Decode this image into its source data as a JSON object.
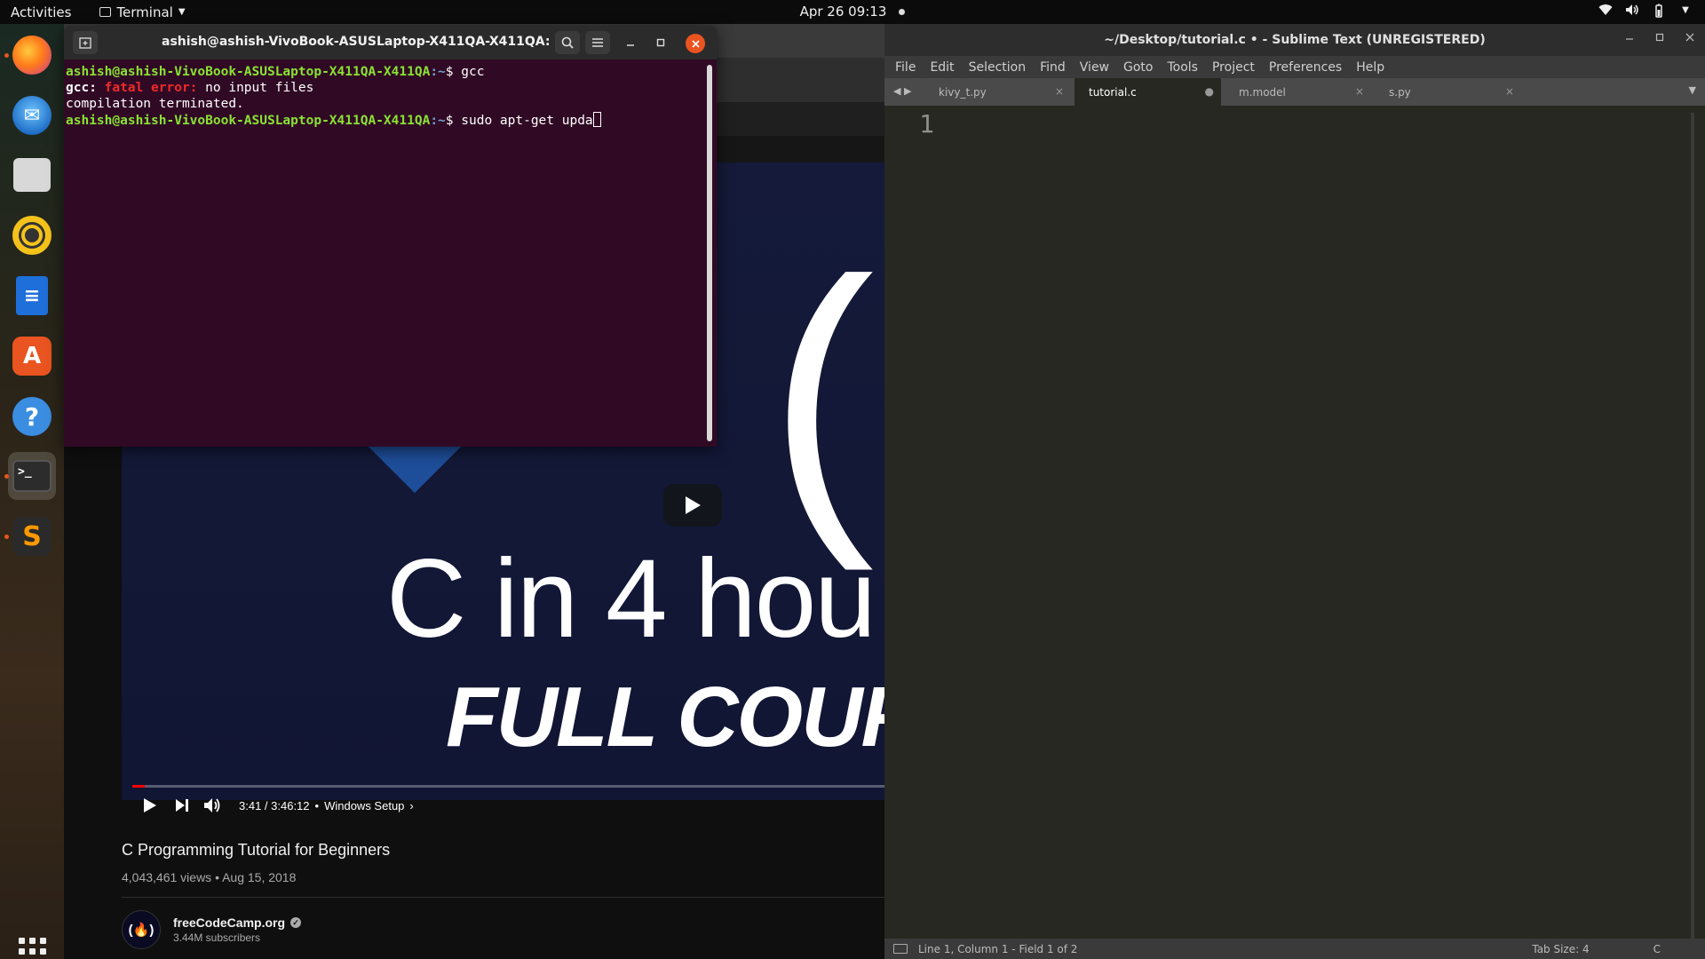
{
  "topbar": {
    "activities": "Activities",
    "app_menu": "Terminal",
    "clock": "Apr 26  09:13"
  },
  "dock": {
    "items": [
      {
        "name": "Firefox",
        "icon": "firefox-icon"
      },
      {
        "name": "Thunderbird",
        "icon": "thunderbird-icon"
      },
      {
        "name": "Files",
        "icon": "files-icon"
      },
      {
        "name": "Rhythmbox",
        "icon": "rhythmbox-icon"
      },
      {
        "name": "LibreOffice Writer",
        "icon": "writer-icon"
      },
      {
        "name": "Ubuntu Software",
        "icon": "software-store-icon"
      },
      {
        "name": "Help",
        "icon": "help-icon"
      },
      {
        "name": "Terminal",
        "icon": "terminal-icon",
        "active": true
      },
      {
        "name": "Sublime Text",
        "icon": "sublime-icon"
      },
      {
        "name": "Show Applications",
        "icon": "apps-grid-icon"
      }
    ]
  },
  "terminal": {
    "title": "ashish@ashish-VivoBook-ASUSLaptop-X411QA-X411QA: ~",
    "prompt_user": "ashish@ashish-VivoBook-ASUSLaptop-X411QA-X411QA",
    "prompt_path": "~",
    "lines": {
      "cmd1": "gcc",
      "err_prefix": "gcc: ",
      "err_kind": "fatal error: ",
      "err_msg": "no input files",
      "terminated": "compilation terminated.",
      "cmd2": "sudo apt-get upda"
    }
  },
  "video": {
    "title_text": "C in 4 hou",
    "subtitle_text": "FULL COURS",
    "paren": "(",
    "time": "3:41 / 3:46:12",
    "chapter": "Windows Setup",
    "progress_fraction": 0.016,
    "video_title": "C Programming Tutorial for Beginners",
    "meta": "4,043,461 views • Aug 15, 2018",
    "channel_name": "freeCodeCamp.org",
    "subscribers": "3.44M subscribers",
    "avatar_text": "(🔥)"
  },
  "sublime": {
    "title": "~/Desktop/tutorial.c • - Sublime Text (UNREGISTERED)",
    "menu": [
      "File",
      "Edit",
      "Selection",
      "Find",
      "View",
      "Goto",
      "Tools",
      "Project",
      "Preferences",
      "Help"
    ],
    "tabs": [
      {
        "label": "kivy_t.py",
        "close": "×"
      },
      {
        "label": "tutorial.c",
        "close": "●"
      },
      {
        "label": "m.model",
        "close": "×"
      },
      {
        "label": "s.py",
        "close": "×"
      }
    ],
    "line_number": "1",
    "status_left": "Line 1, Column 1 - Field 1 of 2",
    "tab_size": "Tab Size: 4",
    "syntax": "C"
  },
  "colors": {
    "terminal_bg": "#300a24",
    "prompt_user": "#8ae234",
    "prompt_path": "#729fcf",
    "error": "#ef2929",
    "ubuntu_orange": "#e95420",
    "sublime_bg": "#272822"
  }
}
